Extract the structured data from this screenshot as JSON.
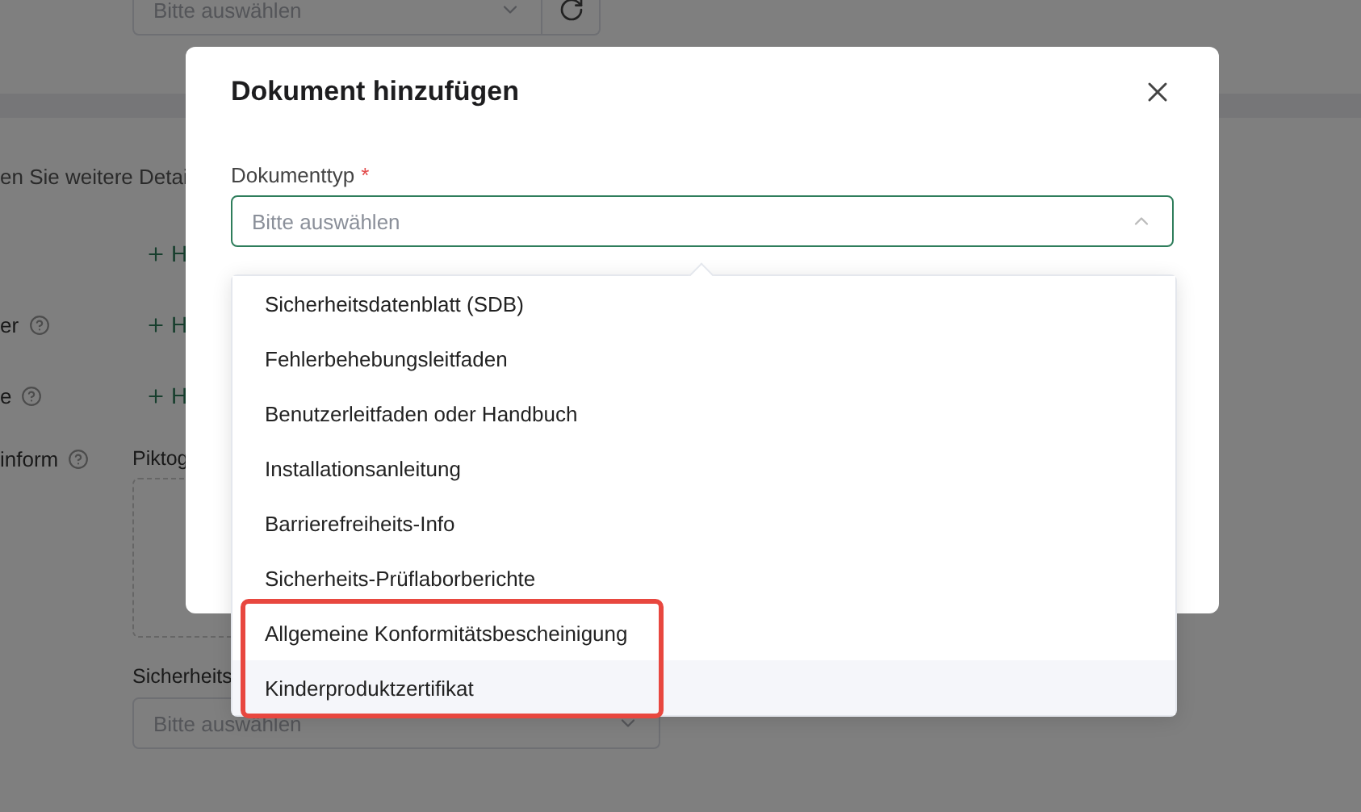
{
  "background": {
    "top_select": {
      "placeholder": "Bitte auswählen"
    },
    "intro": "en Sie weitere Detai",
    "add_rows": [
      {
        "action": "H"
      },
      {
        "label": "er",
        "action": "H"
      },
      {
        "label": "e",
        "action": "H"
      }
    ],
    "pictogram_row": {
      "label": "inform",
      "field_label": "Piktog"
    },
    "safety": {
      "label": "Sicherheits",
      "placeholder": "Bitte auswählen"
    }
  },
  "dialog": {
    "title": "Dokument hinzufügen",
    "field": {
      "label": "Dokumenttyp",
      "required_mark": "*",
      "placeholder": "Bitte auswählen",
      "expanded": true
    },
    "options": [
      {
        "label": "Sicherheitsdatenblatt (SDB)",
        "highlighted": false,
        "framed": false
      },
      {
        "label": "Fehlerbehebungsleitfaden",
        "highlighted": false,
        "framed": false
      },
      {
        "label": "Benutzerleitfaden oder Handbuch",
        "highlighted": false,
        "framed": false
      },
      {
        "label": "Installationsanleitung",
        "highlighted": false,
        "framed": false
      },
      {
        "label": "Barrierefreiheits-Info",
        "highlighted": false,
        "framed": false
      },
      {
        "label": "Sicherheits-Prüflaborberichte",
        "highlighted": false,
        "framed": false
      },
      {
        "label": "Allgemeine Konformitätsbescheinigung",
        "highlighted": false,
        "framed": true
      },
      {
        "label": "Kinderproduktzertifikat",
        "highlighted": true,
        "framed": true
      }
    ]
  }
}
